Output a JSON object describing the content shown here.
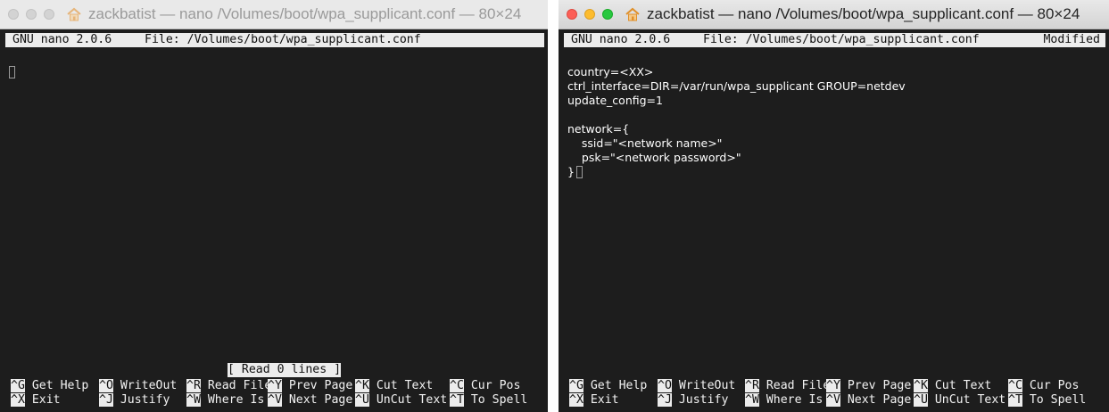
{
  "windows": [
    {
      "title": "zackbatist — nano /Volumes/boot/wpa_supplicant.conf — 80×24",
      "active": false,
      "header": {
        "version": "GNU nano 2.0.6",
        "file": "File: /Volumes/boot/wpa_supplicant.conf",
        "modified": ""
      },
      "status_message": "[ Read 0 lines ]",
      "lines": []
    },
    {
      "title": "zackbatist — nano /Volumes/boot/wpa_supplicant.conf — 80×24",
      "active": true,
      "header": {
        "version": "GNU nano 2.0.6",
        "file": "File: /Volumes/boot/wpa_supplicant.conf",
        "modified": "Modified"
      },
      "status_message": "",
      "lines": [
        "country=<XX>",
        "ctrl_interface=DIR=/var/run/wpa_supplicant GROUP=netdev",
        "update_config=1",
        "",
        "network={",
        "    ssid=\"<network name>\"",
        "    psk=\"<network password>\"",
        "}"
      ]
    }
  ],
  "shortcuts": {
    "row1": [
      {
        "key": "^G",
        "label": "Get Help"
      },
      {
        "key": "^O",
        "label": "WriteOut"
      },
      {
        "key": "^R",
        "label": "Read File"
      },
      {
        "key": "^Y",
        "label": "Prev Page"
      },
      {
        "key": "^K",
        "label": "Cut Text"
      },
      {
        "key": "^C",
        "label": "Cur Pos"
      }
    ],
    "row2": [
      {
        "key": "^X",
        "label": "Exit"
      },
      {
        "key": "^J",
        "label": "Justify"
      },
      {
        "key": "^W",
        "label": "Where Is"
      },
      {
        "key": "^V",
        "label": "Next Page"
      },
      {
        "key": "^U",
        "label": "UnCut Text"
      },
      {
        "key": "^T",
        "label": "To Spell"
      }
    ]
  },
  "icons": {
    "home": "home-icon"
  },
  "colors": {
    "terminal_bg": "#1d1d1d",
    "terminal_fg": "#f2f2f2",
    "inverse_bg": "#ececec",
    "close": "#fc5f57",
    "minimize": "#fdbc2e",
    "zoom": "#28c840",
    "home_icon": "#e0902a"
  }
}
